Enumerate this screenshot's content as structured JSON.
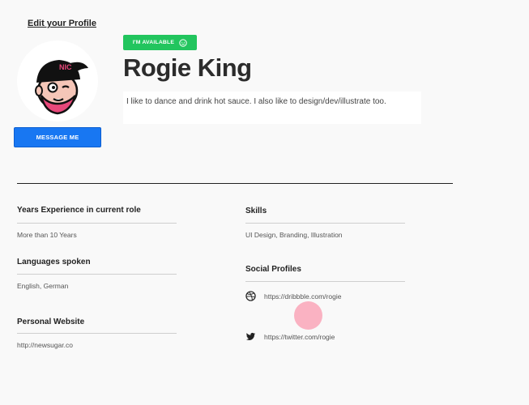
{
  "header": {
    "edit_profile_label": "Edit your Profile"
  },
  "profile": {
    "availability_badge": "I'M AVAILABLE",
    "name": "Rogie King",
    "bio": "I like to dance and drink hot sauce. I also like to design/dev/illustrate too.",
    "message_button_label": "MESSAGE ME",
    "avatar_icon": "avatar-illustration"
  },
  "details": {
    "experience": {
      "title": "Years Experience in current role",
      "value": "More than 10 Years"
    },
    "languages": {
      "title": "Languages spoken",
      "value": "English, German"
    },
    "website": {
      "title": "Personal Website",
      "value": "http://newsugar.co"
    },
    "skills": {
      "title": "Skills",
      "value": "UI Design, Branding, Illustration"
    },
    "social": {
      "title": "Social Profiles",
      "items": [
        {
          "icon": "dribbble-icon",
          "url": "https://dribbble.com/rogie"
        },
        {
          "icon": "twitter-icon",
          "url": "https://twitter.com/rogie"
        }
      ]
    }
  },
  "colors": {
    "primary": "#1877f2",
    "available": "#22c55e",
    "background": "#f9f9f9",
    "cursor_highlight": "#fa8ca5"
  }
}
